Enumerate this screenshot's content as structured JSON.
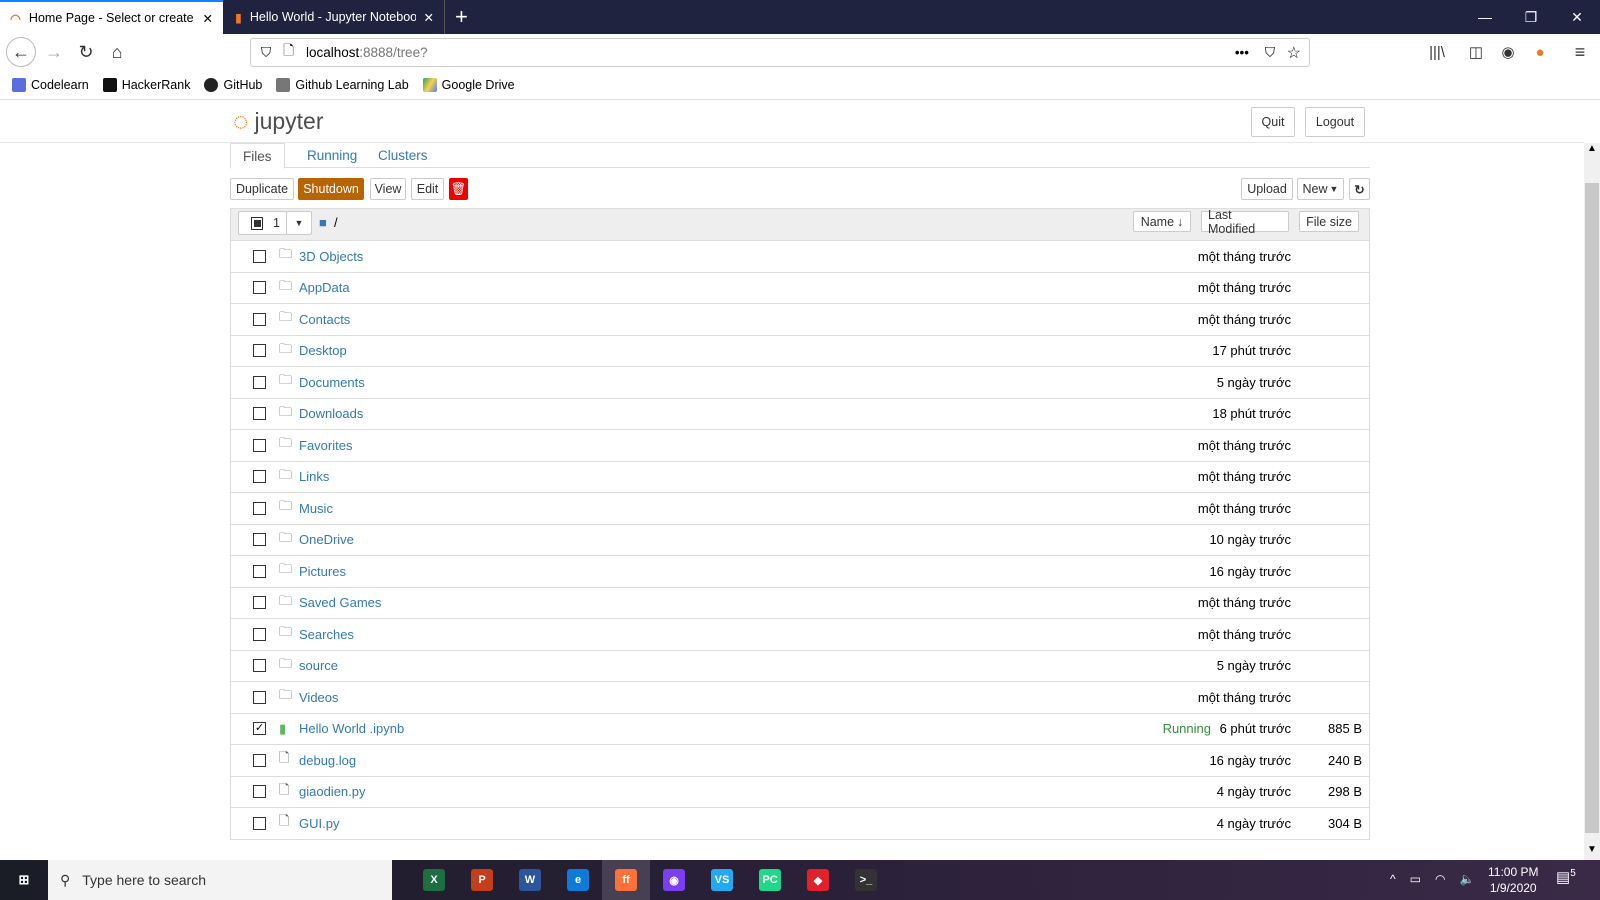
{
  "browser": {
    "tabs": [
      {
        "title": "Home Page - Select or create a",
        "active": true
      },
      {
        "title": "Hello World - Jupyter Notebook",
        "active": false
      }
    ],
    "url_host": "localhost",
    "url_path": ":8888/tree?",
    "bookmarks": [
      "Codelearn",
      "HackerRank",
      "GitHub",
      "Github Learning Lab",
      "Google Drive"
    ]
  },
  "jupyter": {
    "logo": "jupyter",
    "quit": "Quit",
    "logout": "Logout",
    "tabs": [
      "Files",
      "Running",
      "Clusters"
    ],
    "toolbar": {
      "duplicate": "Duplicate",
      "shutdown": "Shutdown",
      "view": "View",
      "edit": "Edit",
      "upload": "Upload",
      "new": "New"
    },
    "selected_count": "1",
    "path": "/",
    "sort": {
      "name": "Name",
      "last_modified": "Last Modified",
      "file_size": "File size"
    },
    "files": [
      {
        "type": "folder",
        "name": "3D Objects",
        "modified": "một tháng trước",
        "size": "",
        "checked": false
      },
      {
        "type": "folder",
        "name": "AppData",
        "modified": "một tháng trước",
        "size": "",
        "checked": false
      },
      {
        "type": "folder",
        "name": "Contacts",
        "modified": "một tháng trước",
        "size": "",
        "checked": false
      },
      {
        "type": "folder",
        "name": "Desktop",
        "modified": "17 phút trước",
        "size": "",
        "checked": false
      },
      {
        "type": "folder",
        "name": "Documents",
        "modified": "5 ngày trước",
        "size": "",
        "checked": false
      },
      {
        "type": "folder",
        "name": "Downloads",
        "modified": "18 phút trước",
        "size": "",
        "checked": false
      },
      {
        "type": "folder",
        "name": "Favorites",
        "modified": "một tháng trước",
        "size": "",
        "checked": false
      },
      {
        "type": "folder",
        "name": "Links",
        "modified": "một tháng trước",
        "size": "",
        "checked": false
      },
      {
        "type": "folder",
        "name": "Music",
        "modified": "một tháng trước",
        "size": "",
        "checked": false
      },
      {
        "type": "folder",
        "name": "OneDrive",
        "modified": "10 ngày trước",
        "size": "",
        "checked": false
      },
      {
        "type": "folder",
        "name": "Pictures",
        "modified": "16 ngày trước",
        "size": "",
        "checked": false
      },
      {
        "type": "folder",
        "name": "Saved Games",
        "modified": "một tháng trước",
        "size": "",
        "checked": false
      },
      {
        "type": "folder",
        "name": "Searches",
        "modified": "một tháng trước",
        "size": "",
        "checked": false
      },
      {
        "type": "folder",
        "name": "source",
        "modified": "5 ngày trước",
        "size": "",
        "checked": false
      },
      {
        "type": "folder",
        "name": "Videos",
        "modified": "một tháng trước",
        "size": "",
        "checked": false
      },
      {
        "type": "notebook",
        "name": "Hello World .ipynb",
        "status": "Running",
        "modified": "6 phút trước",
        "size": "885 B",
        "checked": true
      },
      {
        "type": "file",
        "name": "debug.log",
        "modified": "16 ngày trước",
        "size": "240 B",
        "checked": false
      },
      {
        "type": "file",
        "name": "giaodien.py",
        "modified": "4 ngày trước",
        "size": "298 B",
        "checked": false
      },
      {
        "type": "file",
        "name": "GUI.py",
        "modified": "4 ngày trước",
        "size": "304 B",
        "checked": false
      }
    ]
  },
  "taskbar": {
    "search_placeholder": "Type here to search",
    "time": "11:00 PM",
    "date": "1/9/2020",
    "notifications": "5",
    "apps": [
      "X",
      "P",
      "W",
      "e",
      "ff",
      "◉",
      "VS",
      "PC",
      "◆",
      ">_"
    ]
  },
  "colors": {
    "shutdown": "#b86400",
    "trash": "#e00",
    "link": "#337ab7",
    "running": "#3c8c3c"
  }
}
